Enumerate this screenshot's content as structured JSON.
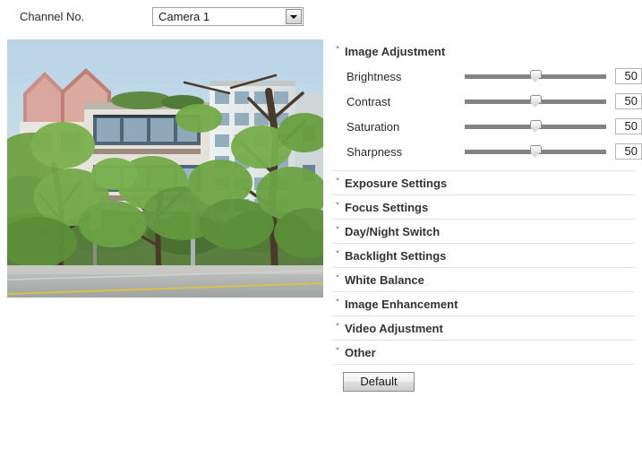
{
  "channel": {
    "label": "Channel No.",
    "selected": "Camera 1",
    "options": [
      "Camera 1"
    ],
    "dropdown_icon": "chevron-down-icon"
  },
  "preview": {
    "alt": "Live camera preview showing residential apartment buildings behind green trees with a road in the foreground"
  },
  "panel": {
    "expanded_caret": "˄",
    "collapsed_caret": "˅",
    "sections": [
      {
        "title": "Image Adjustment",
        "expanded": true
      },
      {
        "title": "Exposure Settings",
        "expanded": false
      },
      {
        "title": "Focus Settings",
        "expanded": false
      },
      {
        "title": "Day/Night Switch",
        "expanded": false
      },
      {
        "title": "Backlight Settings",
        "expanded": false
      },
      {
        "title": "White Balance",
        "expanded": false
      },
      {
        "title": "Image Enhancement",
        "expanded": false
      },
      {
        "title": "Video Adjustment",
        "expanded": false
      },
      {
        "title": "Other",
        "expanded": false
      }
    ],
    "image_adjustment": {
      "sliders": [
        {
          "label": "Brightness",
          "value": "50",
          "percent": 50
        },
        {
          "label": "Contrast",
          "value": "50",
          "percent": 50
        },
        {
          "label": "Saturation",
          "value": "50",
          "percent": 50
        },
        {
          "label": "Sharpness",
          "value": "50",
          "percent": 50
        }
      ]
    },
    "default_button": "Default"
  },
  "colors": {
    "page_background": "#ffffff",
    "text": "#333333",
    "slider_track": "#838383",
    "divider": "#e2e2e2",
    "input_border": "#b5b5b5"
  }
}
